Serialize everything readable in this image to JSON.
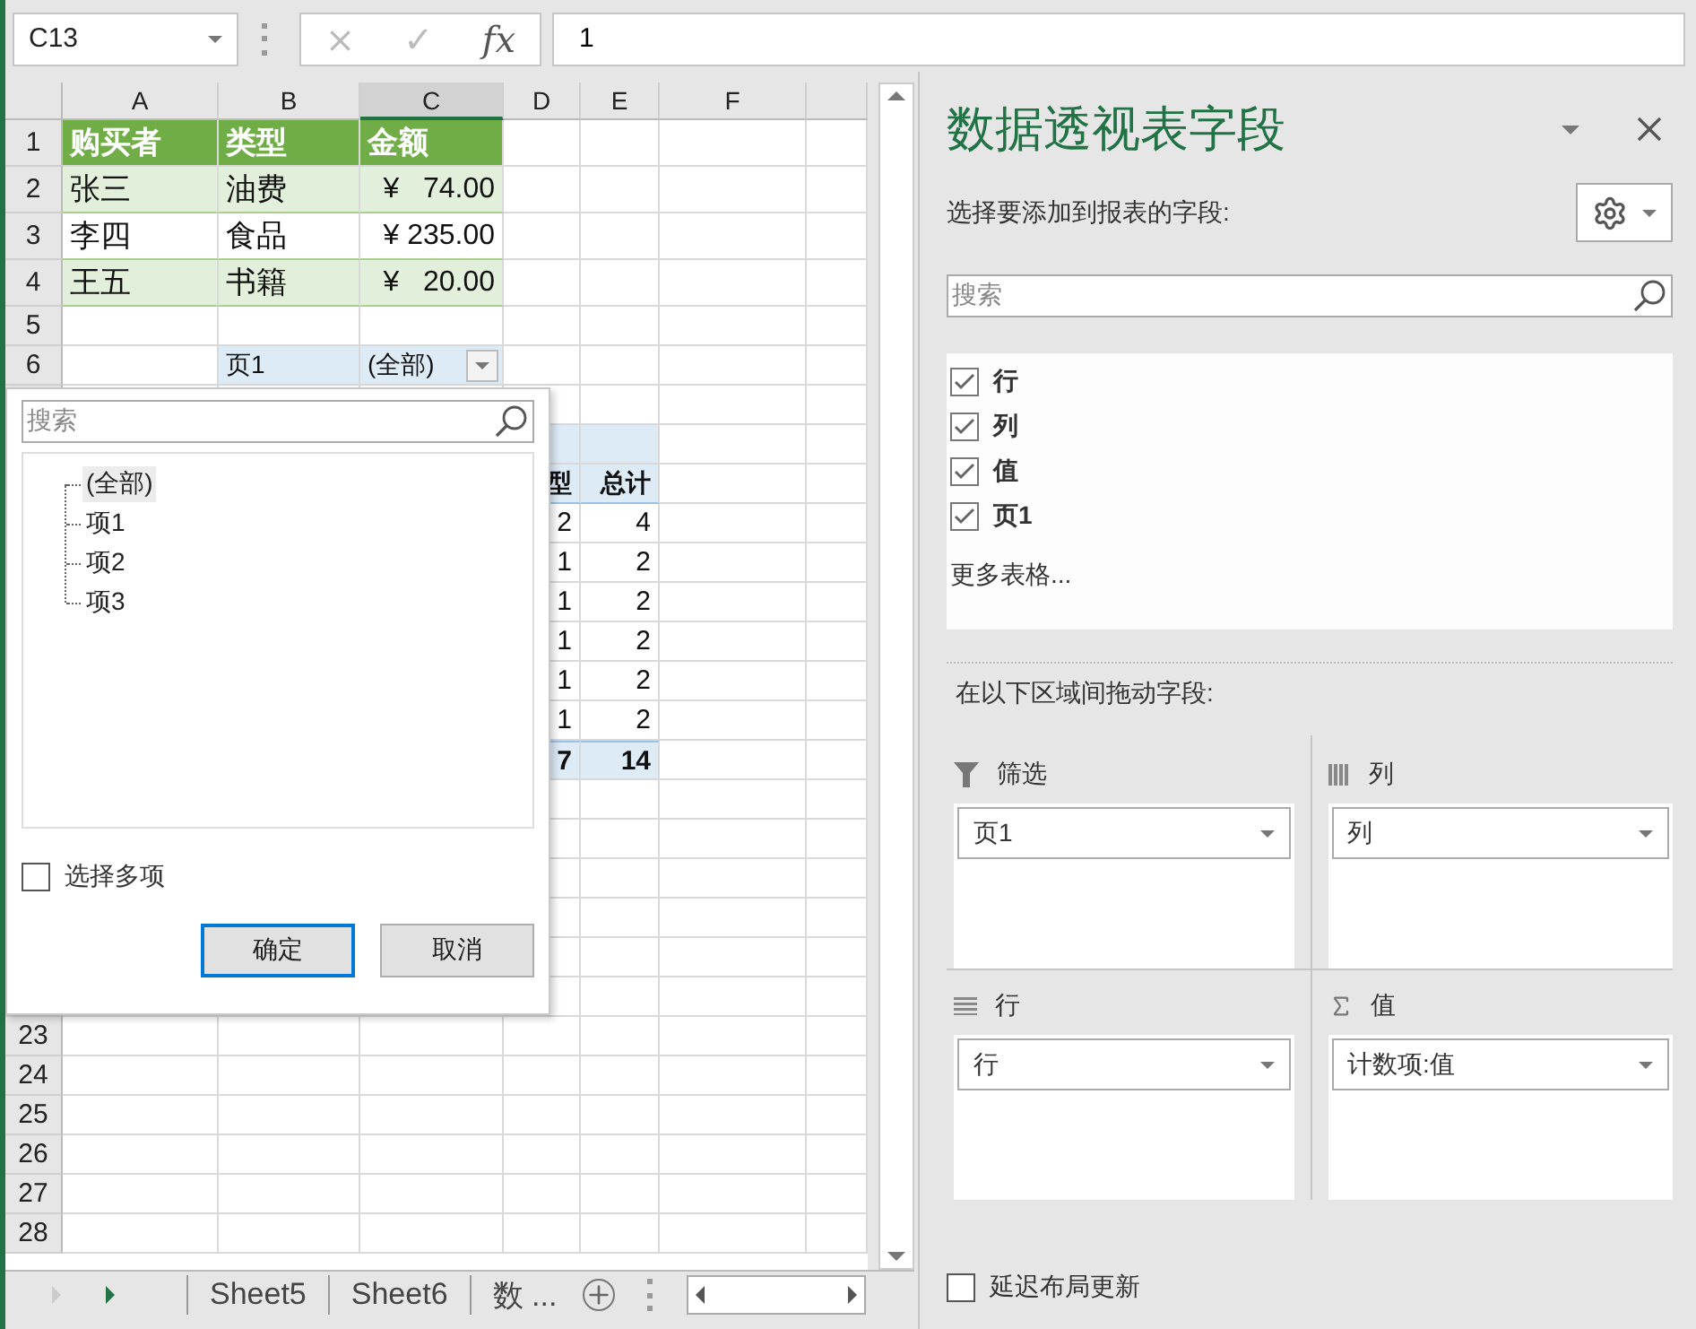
{
  "formula_bar": {
    "name_box": "C13",
    "cancel": "×",
    "enter": "✓",
    "function": "fx",
    "formula": "1"
  },
  "sheet": {
    "columns": [
      {
        "label": "A",
        "selected": false
      },
      {
        "label": "B",
        "selected": false
      },
      {
        "label": "C",
        "selected": true
      },
      {
        "label": "D",
        "selected": false
      },
      {
        "label": "E",
        "selected": false
      },
      {
        "label": "F",
        "selected": false
      },
      {
        "selected": false
      }
    ],
    "rows": [
      {
        "header": "1",
        "cells": [
          {
            "text": "购买者",
            "kind": "head"
          },
          {
            "text": "类型",
            "kind": "head"
          },
          {
            "text": "金额",
            "kind": "head"
          },
          null,
          null,
          null,
          null
        ]
      },
      {
        "header": "2",
        "cells": [
          {
            "text": "张三",
            "kind": "band"
          },
          {
            "text": "油费",
            "kind": "band"
          },
          {
            "text": "¥   74.00",
            "kind": "band-currency"
          },
          null,
          null,
          null,
          null
        ]
      },
      {
        "header": "3",
        "cells": [
          {
            "text": "李四",
            "kind": "plain"
          },
          {
            "text": "食品",
            "kind": "plain"
          },
          {
            "text": "¥ 235.00",
            "kind": "plain-currency"
          },
          null,
          null,
          null,
          null
        ]
      },
      {
        "header": "4",
        "cells": [
          {
            "text": "王五",
            "kind": "band"
          },
          {
            "text": "书籍",
            "kind": "band"
          },
          {
            "text": "¥   20.00",
            "kind": "band-currency"
          },
          null,
          null,
          null,
          null
        ]
      },
      {
        "header": "5",
        "cells": [
          null,
          null,
          null,
          null,
          null,
          null,
          null
        ]
      },
      {
        "header": "6",
        "cells": [
          null,
          {
            "text": "页1",
            "kind": "filter-label"
          },
          {
            "text": "(全部)",
            "kind": "filter-value"
          },
          null,
          null,
          null,
          null
        ]
      },
      {
        "cells": [
          null,
          null,
          null,
          null,
          null,
          null,
          null
        ]
      },
      {
        "cells": [
          null,
          null,
          null,
          {
            "kind": "pivot"
          },
          {
            "kind": "pivot"
          },
          null,
          null
        ]
      },
      {
        "cells": [
          null,
          null,
          null,
          {
            "text": "型",
            "kind": "pivot-head"
          },
          {
            "text": "总计",
            "kind": "pivot-head"
          },
          null,
          null
        ]
      },
      {
        "cells": [
          null,
          null,
          null,
          {
            "text": "2",
            "kind": "number"
          },
          {
            "text": "4",
            "kind": "number"
          },
          null,
          null
        ]
      },
      {
        "cells": [
          null,
          null,
          null,
          {
            "text": "1",
            "kind": "number"
          },
          {
            "text": "2",
            "kind": "number"
          },
          null,
          null
        ]
      },
      {
        "cells": [
          null,
          null,
          null,
          {
            "text": "1",
            "kind": "number"
          },
          {
            "text": "2",
            "kind": "number"
          },
          null,
          null
        ]
      },
      {
        "cells": [
          null,
          null,
          null,
          {
            "text": "1",
            "kind": "number"
          },
          {
            "text": "2",
            "kind": "number"
          },
          null,
          null
        ]
      },
      {
        "cells": [
          null,
          null,
          null,
          {
            "text": "1",
            "kind": "number"
          },
          {
            "text": "2",
            "kind": "number"
          },
          null,
          null
        ]
      },
      {
        "cells": [
          null,
          null,
          null,
          {
            "text": "1",
            "kind": "number"
          },
          {
            "text": "2",
            "kind": "number"
          },
          null,
          null
        ]
      },
      {
        "cells": [
          null,
          null,
          null,
          {
            "text": "7",
            "kind": "pivot-total"
          },
          {
            "text": "14",
            "kind": "pivot-total"
          },
          null,
          null
        ]
      },
      {
        "cells": [
          null,
          null,
          null,
          null,
          null,
          null,
          null
        ]
      },
      {
        "cells": [
          null,
          null,
          null,
          null,
          null,
          null,
          null
        ]
      },
      {
        "cells": [
          null,
          null,
          null,
          null,
          null,
          null,
          null
        ]
      },
      {
        "cells": [
          null,
          null,
          null,
          null,
          null,
          null,
          null
        ]
      },
      {
        "cells": [
          null,
          null,
          null,
          null,
          null,
          null,
          null
        ]
      },
      {
        "cells": [
          null,
          null,
          null,
          null,
          null,
          null,
          null
        ]
      },
      {
        "header": "23",
        "cells": [
          null,
          null,
          null,
          null,
          null,
          null,
          null
        ]
      },
      {
        "header": "24",
        "cells": [
          null,
          null,
          null,
          null,
          null,
          null,
          null
        ]
      },
      {
        "header": "25",
        "cells": [
          null,
          null,
          null,
          null,
          null,
          null,
          null
        ]
      },
      {
        "header": "26",
        "cells": [
          null,
          null,
          null,
          null,
          null,
          null,
          null
        ]
      },
      {
        "header": "27",
        "cells": [
          null,
          null,
          null,
          null,
          null,
          null,
          null
        ]
      },
      {
        "header": "28",
        "cells": [
          null,
          null,
          null,
          null,
          null,
          null,
          null
        ]
      }
    ]
  },
  "filter_dropdown": {
    "search": {
      "placeholder": "搜索"
    },
    "items": [
      {
        "label": "(全部)",
        "selected": true
      },
      {
        "label": "项1",
        "selected": false
      },
      {
        "label": "项2",
        "selected": false
      },
      {
        "label": "项3",
        "selected": false
      }
    ],
    "multi_select": {
      "label": "选择多项",
      "checked": false
    },
    "buttons": [
      {
        "label": "确定",
        "default": true
      },
      {
        "label": "取消",
        "default": false
      }
    ]
  },
  "sheet_tabs": {
    "tabs": [
      "Sheet5",
      "Sheet6",
      "数 ..."
    ]
  },
  "pivot_panel": {
    "title": "数据透视表字段",
    "prompt": "选择要添加到报表的字段:",
    "search": {
      "placeholder": "搜索"
    },
    "fields": [
      {
        "label": "行",
        "checked": true
      },
      {
        "label": "列",
        "checked": true
      },
      {
        "label": "值",
        "checked": true
      },
      {
        "label": "页1",
        "checked": true
      }
    ],
    "more_tables": "更多表格...",
    "areas_prompt": "在以下区域间拖动字段:",
    "areas": [
      {
        "kind": "filter",
        "label": "筛选",
        "items": [
          "页1"
        ]
      },
      {
        "kind": "columns",
        "label": "列",
        "items": [
          "列"
        ]
      },
      {
        "kind": "rows",
        "label": "行",
        "items": [
          "行"
        ]
      },
      {
        "kind": "values",
        "label": "值",
        "items": [
          "计数项:值"
        ]
      }
    ],
    "defer": {
      "label": "延迟布局更新",
      "checked": false
    }
  }
}
